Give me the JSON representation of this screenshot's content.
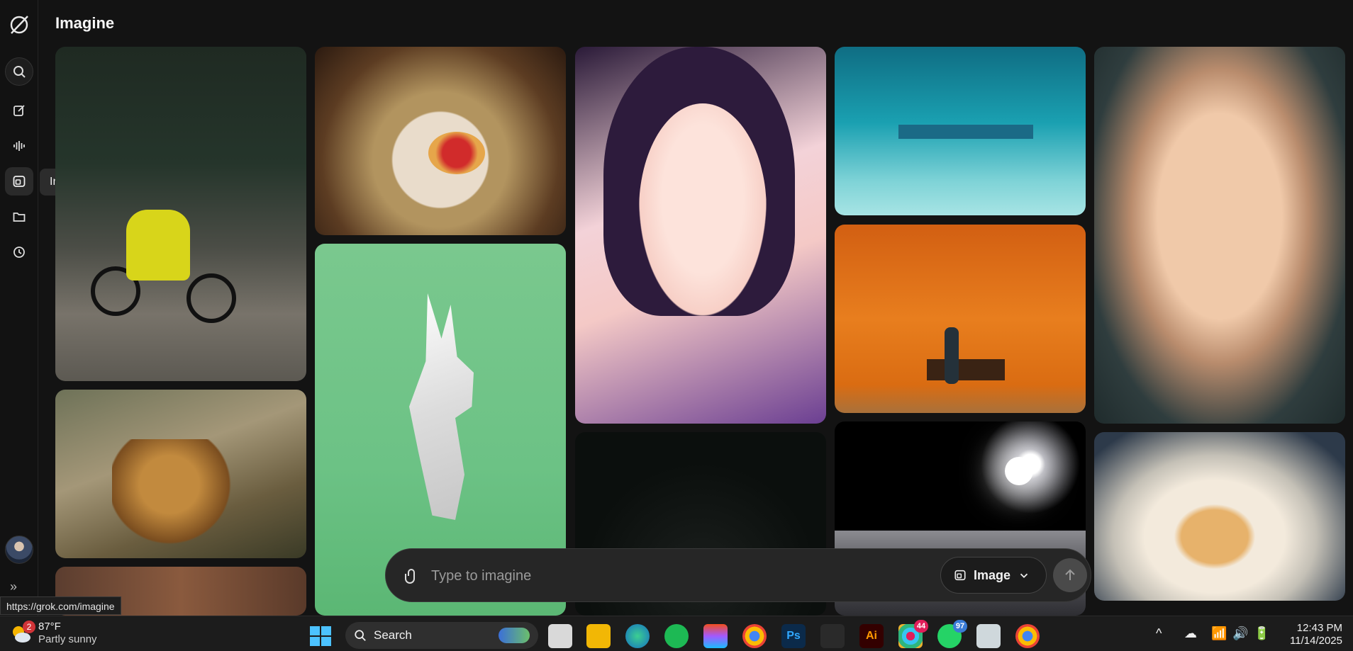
{
  "app": {
    "title": "Imagine"
  },
  "sidebar": {
    "tooltip": "Imagine",
    "items": [
      {
        "icon": "search-icon"
      },
      {
        "icon": "edit-icon"
      },
      {
        "icon": "voice-icon"
      },
      {
        "icon": "imagine-icon"
      },
      {
        "icon": "folder-icon"
      },
      {
        "icon": "history-icon"
      }
    ]
  },
  "prompt": {
    "placeholder": "Type to imagine",
    "mode_label": "Image"
  },
  "status_url": "https://grok.com/imagine",
  "taskbar": {
    "weather": {
      "temp": "87°F",
      "condition": "Partly sunny",
      "badge": "2"
    },
    "search_label": "Search",
    "badges": {
      "slack": "44",
      "whatsapp": "97"
    },
    "ps_label": "Ps",
    "ai_label": "Ai",
    "time": "12:43 PM",
    "date": "11/14/2025"
  }
}
